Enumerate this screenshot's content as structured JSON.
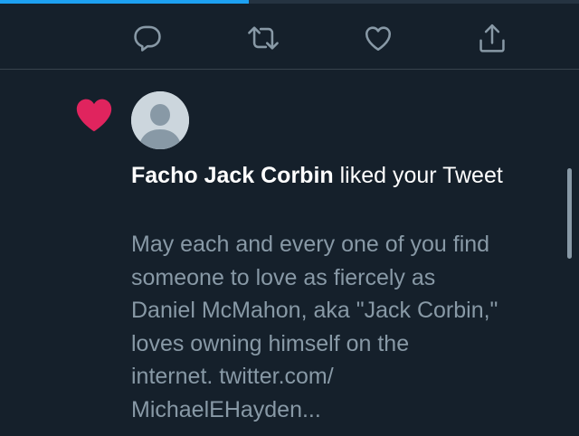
{
  "progress": {
    "fraction": 0.43
  },
  "actions": [
    {
      "icon": "reply-icon"
    },
    {
      "icon": "retweet-icon"
    },
    {
      "icon": "like-icon"
    },
    {
      "icon": "share-icon"
    }
  ],
  "notification": {
    "icon": "heart-icon",
    "avatar_icon": "default-avatar-icon",
    "user_name": "Facho Jack Corbin",
    "action_text": " liked your Tweet",
    "tweet_lines": [
      "May each and every one of you find",
      "someone to love as fiercely as",
      "Daniel McMahon, aka \"Jack Corbin,\"",
      "loves owning himself on the",
      "internet. twitter.com/",
      "MichaelEHayden..."
    ]
  },
  "colors": {
    "background": "#15202b",
    "accent": "#1da1f2",
    "like": "#e0245e",
    "muted_text": "#8899a6",
    "icon": "#8899a6"
  }
}
